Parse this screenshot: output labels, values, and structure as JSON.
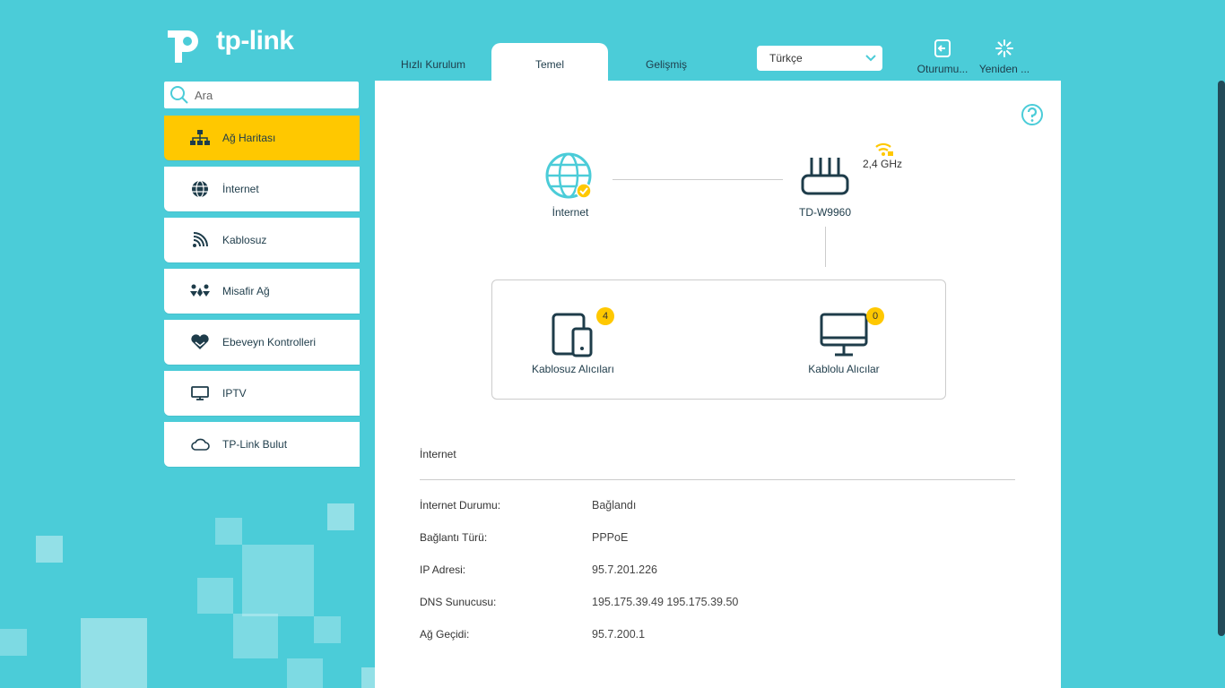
{
  "brand": {
    "logo_text": "tp-link",
    "accent": "#ffc800",
    "bg": "#4bccd8",
    "dark": "#1e3c4a"
  },
  "tabs": [
    {
      "label": "Hızlı Kurulum",
      "active": false
    },
    {
      "label": "Temel",
      "active": true
    },
    {
      "label": "Gelişmiş",
      "active": false
    }
  ],
  "language": {
    "selected": "Türkçe"
  },
  "top_actions": {
    "logout": "Oturumu...",
    "reboot": "Yeniden ..."
  },
  "search": {
    "placeholder": "Ara"
  },
  "sidebar": {
    "items": [
      {
        "label": "Ağ Haritası",
        "icon": "network-map-icon",
        "active": true
      },
      {
        "label": "İnternet",
        "icon": "globe-icon",
        "active": false
      },
      {
        "label": "Kablosuz",
        "icon": "wireless-icon",
        "active": false
      },
      {
        "label": "Misafir Ağ",
        "icon": "guest-network-icon",
        "active": false
      },
      {
        "label": "Ebeveyn Kontrolleri",
        "icon": "parental-controls-icon",
        "active": false
      },
      {
        "label": "IPTV",
        "icon": "tv-icon",
        "active": false
      },
      {
        "label": "TP-Link Bulut",
        "icon": "cloud-icon",
        "active": false
      }
    ]
  },
  "map": {
    "internet_label": "İnternet",
    "router_label": "TD-W9960",
    "band_label": "2,4 GHz",
    "wireless_clients": {
      "label": "Kablosuz Alıcıları",
      "count": "4"
    },
    "wired_clients": {
      "label": "Kablolu Alıcılar",
      "count": "0"
    }
  },
  "internet_info": {
    "title": "İnternet",
    "rows": [
      {
        "key": "İnternet Durumu:",
        "value": "Bağlandı"
      },
      {
        "key": "Bağlantı Türü:",
        "value": "PPPoE"
      },
      {
        "key": "IP Adresi:",
        "value": "95.7.201.226"
      },
      {
        "key": "DNS Sunucusu:",
        "value": "195.175.39.49 195.175.39.50"
      },
      {
        "key": "Ağ Geçidi:",
        "value": "95.7.200.1"
      }
    ]
  }
}
